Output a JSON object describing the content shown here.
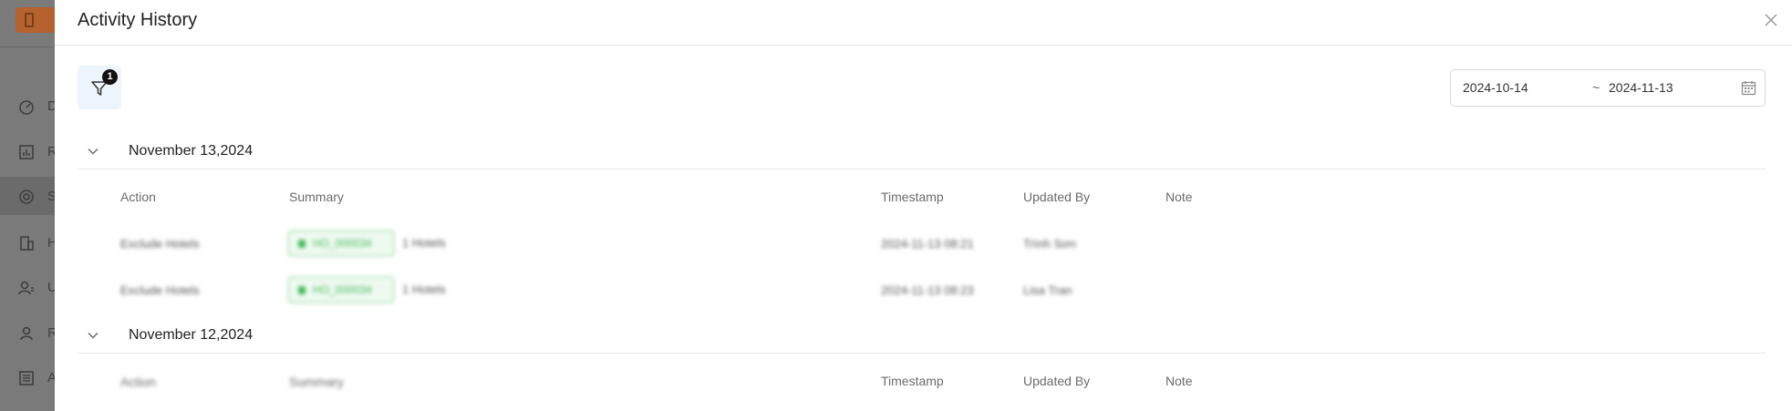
{
  "background_app": {
    "nav_items": [
      {
        "icon": "dashboard-icon",
        "letter": "D"
      },
      {
        "icon": "chart-icon",
        "letter": "R"
      },
      {
        "icon": "target-icon",
        "letter": "S"
      },
      {
        "icon": "building-icon",
        "letter": "H"
      },
      {
        "icon": "user-list-icon",
        "letter": "U"
      },
      {
        "icon": "user-icon",
        "letter": "R"
      },
      {
        "icon": "list-icon",
        "letter": "A"
      }
    ]
  },
  "modal": {
    "title": "Activity History",
    "filter_badge": "1",
    "date_range": {
      "start": "2024-10-14",
      "separator": "~",
      "end": "2024-11-13"
    },
    "columns": {
      "action": "Action",
      "summary": "Summary",
      "timestamp": "Timestamp",
      "updated_by": "Updated By",
      "note": "Note"
    },
    "groups": [
      {
        "date": "November 13,2024",
        "rows": [
          {
            "action": "Exclude Hotels",
            "summary_tag": "HO_000034",
            "summary_text": "1 Hotels",
            "timestamp": "2024-11-13 08:21",
            "updated_by": "Trình Sơn",
            "note": ""
          },
          {
            "action": "Exclude Hotels",
            "summary_tag": "HO_000034",
            "summary_text": "1 Hotels",
            "timestamp": "2024-11-13 08:23",
            "updated_by": "Lisa Tran",
            "note": ""
          }
        ]
      },
      {
        "date": "November 12,2024",
        "rows": []
      }
    ]
  },
  "colors": {
    "accent_green": "#46b85a",
    "filter_bg": "#eef4fb"
  }
}
